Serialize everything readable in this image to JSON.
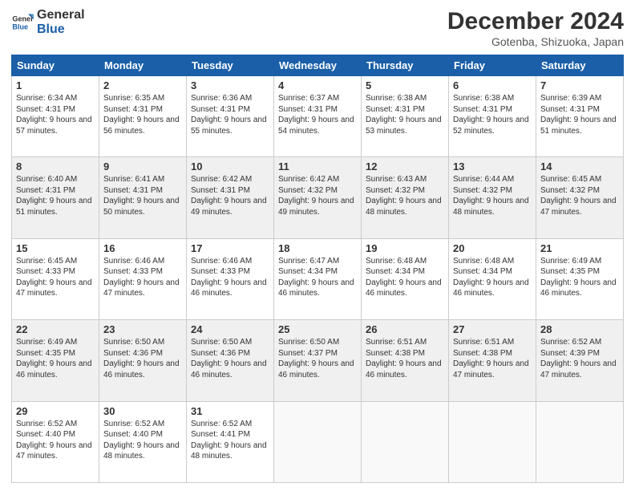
{
  "header": {
    "logo_line1": "General",
    "logo_line2": "Blue",
    "title": "December 2024",
    "subtitle": "Gotenba, Shizuoka, Japan"
  },
  "calendar": {
    "headers": [
      "Sunday",
      "Monday",
      "Tuesday",
      "Wednesday",
      "Thursday",
      "Friday",
      "Saturday"
    ],
    "weeks": [
      [
        {
          "day": "1",
          "sunrise": "Sunrise: 6:34 AM",
          "sunset": "Sunset: 4:31 PM",
          "daylight": "Daylight: 9 hours and 57 minutes."
        },
        {
          "day": "2",
          "sunrise": "Sunrise: 6:35 AM",
          "sunset": "Sunset: 4:31 PM",
          "daylight": "Daylight: 9 hours and 56 minutes."
        },
        {
          "day": "3",
          "sunrise": "Sunrise: 6:36 AM",
          "sunset": "Sunset: 4:31 PM",
          "daylight": "Daylight: 9 hours and 55 minutes."
        },
        {
          "day": "4",
          "sunrise": "Sunrise: 6:37 AM",
          "sunset": "Sunset: 4:31 PM",
          "daylight": "Daylight: 9 hours and 54 minutes."
        },
        {
          "day": "5",
          "sunrise": "Sunrise: 6:38 AM",
          "sunset": "Sunset: 4:31 PM",
          "daylight": "Daylight: 9 hours and 53 minutes."
        },
        {
          "day": "6",
          "sunrise": "Sunrise: 6:38 AM",
          "sunset": "Sunset: 4:31 PM",
          "daylight": "Daylight: 9 hours and 52 minutes."
        },
        {
          "day": "7",
          "sunrise": "Sunrise: 6:39 AM",
          "sunset": "Sunset: 4:31 PM",
          "daylight": "Daylight: 9 hours and 51 minutes."
        }
      ],
      [
        {
          "day": "8",
          "sunrise": "Sunrise: 6:40 AM",
          "sunset": "Sunset: 4:31 PM",
          "daylight": "Daylight: 9 hours and 51 minutes."
        },
        {
          "day": "9",
          "sunrise": "Sunrise: 6:41 AM",
          "sunset": "Sunset: 4:31 PM",
          "daylight": "Daylight: 9 hours and 50 minutes."
        },
        {
          "day": "10",
          "sunrise": "Sunrise: 6:42 AM",
          "sunset": "Sunset: 4:31 PM",
          "daylight": "Daylight: 9 hours and 49 minutes."
        },
        {
          "day": "11",
          "sunrise": "Sunrise: 6:42 AM",
          "sunset": "Sunset: 4:32 PM",
          "daylight": "Daylight: 9 hours and 49 minutes."
        },
        {
          "day": "12",
          "sunrise": "Sunrise: 6:43 AM",
          "sunset": "Sunset: 4:32 PM",
          "daylight": "Daylight: 9 hours and 48 minutes."
        },
        {
          "day": "13",
          "sunrise": "Sunrise: 6:44 AM",
          "sunset": "Sunset: 4:32 PM",
          "daylight": "Daylight: 9 hours and 48 minutes."
        },
        {
          "day": "14",
          "sunrise": "Sunrise: 6:45 AM",
          "sunset": "Sunset: 4:32 PM",
          "daylight": "Daylight: 9 hours and 47 minutes."
        }
      ],
      [
        {
          "day": "15",
          "sunrise": "Sunrise: 6:45 AM",
          "sunset": "Sunset: 4:33 PM",
          "daylight": "Daylight: 9 hours and 47 minutes."
        },
        {
          "day": "16",
          "sunrise": "Sunrise: 6:46 AM",
          "sunset": "Sunset: 4:33 PM",
          "daylight": "Daylight: 9 hours and 47 minutes."
        },
        {
          "day": "17",
          "sunrise": "Sunrise: 6:46 AM",
          "sunset": "Sunset: 4:33 PM",
          "daylight": "Daylight: 9 hours and 46 minutes."
        },
        {
          "day": "18",
          "sunrise": "Sunrise: 6:47 AM",
          "sunset": "Sunset: 4:34 PM",
          "daylight": "Daylight: 9 hours and 46 minutes."
        },
        {
          "day": "19",
          "sunrise": "Sunrise: 6:48 AM",
          "sunset": "Sunset: 4:34 PM",
          "daylight": "Daylight: 9 hours and 46 minutes."
        },
        {
          "day": "20",
          "sunrise": "Sunrise: 6:48 AM",
          "sunset": "Sunset: 4:34 PM",
          "daylight": "Daylight: 9 hours and 46 minutes."
        },
        {
          "day": "21",
          "sunrise": "Sunrise: 6:49 AM",
          "sunset": "Sunset: 4:35 PM",
          "daylight": "Daylight: 9 hours and 46 minutes."
        }
      ],
      [
        {
          "day": "22",
          "sunrise": "Sunrise: 6:49 AM",
          "sunset": "Sunset: 4:35 PM",
          "daylight": "Daylight: 9 hours and 46 minutes."
        },
        {
          "day": "23",
          "sunrise": "Sunrise: 6:50 AM",
          "sunset": "Sunset: 4:36 PM",
          "daylight": "Daylight: 9 hours and 46 minutes."
        },
        {
          "day": "24",
          "sunrise": "Sunrise: 6:50 AM",
          "sunset": "Sunset: 4:36 PM",
          "daylight": "Daylight: 9 hours and 46 minutes."
        },
        {
          "day": "25",
          "sunrise": "Sunrise: 6:50 AM",
          "sunset": "Sunset: 4:37 PM",
          "daylight": "Daylight: 9 hours and 46 minutes."
        },
        {
          "day": "26",
          "sunrise": "Sunrise: 6:51 AM",
          "sunset": "Sunset: 4:38 PM",
          "daylight": "Daylight: 9 hours and 46 minutes."
        },
        {
          "day": "27",
          "sunrise": "Sunrise: 6:51 AM",
          "sunset": "Sunset: 4:38 PM",
          "daylight": "Daylight: 9 hours and 47 minutes."
        },
        {
          "day": "28",
          "sunrise": "Sunrise: 6:52 AM",
          "sunset": "Sunset: 4:39 PM",
          "daylight": "Daylight: 9 hours and 47 minutes."
        }
      ],
      [
        {
          "day": "29",
          "sunrise": "Sunrise: 6:52 AM",
          "sunset": "Sunset: 4:40 PM",
          "daylight": "Daylight: 9 hours and 47 minutes."
        },
        {
          "day": "30",
          "sunrise": "Sunrise: 6:52 AM",
          "sunset": "Sunset: 4:40 PM",
          "daylight": "Daylight: 9 hours and 48 minutes."
        },
        {
          "day": "31",
          "sunrise": "Sunrise: 6:52 AM",
          "sunset": "Sunset: 4:41 PM",
          "daylight": "Daylight: 9 hours and 48 minutes."
        },
        null,
        null,
        null,
        null
      ]
    ]
  }
}
